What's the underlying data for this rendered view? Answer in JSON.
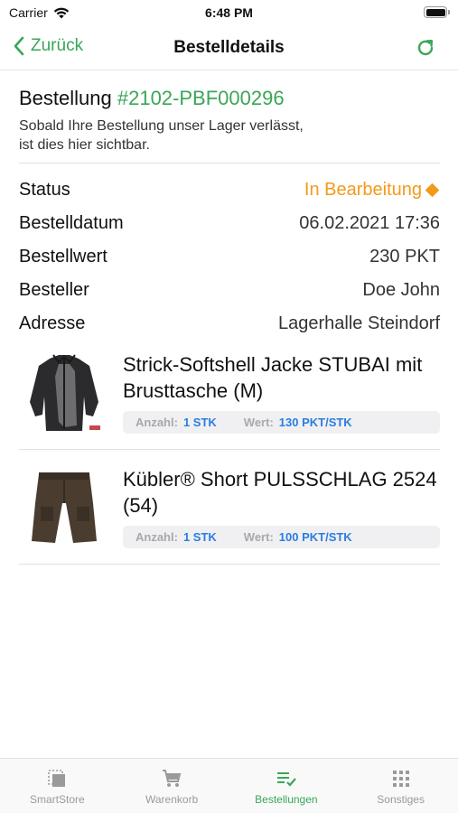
{
  "status_bar": {
    "carrier": "Carrier",
    "time": "6:48 PM"
  },
  "navbar": {
    "back_label": "Zurück",
    "title": "Bestelldetails"
  },
  "order": {
    "heading_prefix": "Bestellung ",
    "number": "#2102-PBF000296",
    "note": "Sobald Ihre Bestellung unser Lager verlässt, ist dies hier sichtbar."
  },
  "details": [
    {
      "label": "Status",
      "value": "In Bearbeitung"
    },
    {
      "label": "Bestelldatum",
      "value": "06.02.2021 17:36"
    },
    {
      "label": "Bestellwert",
      "value": "230 PKT"
    },
    {
      "label": "Besteller",
      "value": "Doe John"
    },
    {
      "label": "Adresse",
      "value": "Lagerhalle Steindorf"
    }
  ],
  "products": [
    {
      "name": "Strick-Softshell Jacke STUBAI mit Brusttasche (M)",
      "quantity_label": "Anzahl:",
      "quantity": "1 STK",
      "value_label": "Wert:",
      "value": "130 PKT/STK"
    },
    {
      "name": "Kübler® Short PULSSCHLAG 2524 (54)",
      "quantity_label": "Anzahl:",
      "quantity": "1 STK",
      "value_label": "Wert:",
      "value": "100 PKT/STK"
    }
  ],
  "tabs": [
    {
      "label": "SmartStore",
      "icon": "store-icon",
      "active": false
    },
    {
      "label": "Warenkorb",
      "icon": "cart-icon",
      "active": false
    },
    {
      "label": "Bestellungen",
      "icon": "orders-icon",
      "active": true
    },
    {
      "label": "Sonstiges",
      "icon": "grid-icon",
      "active": false
    }
  ],
  "colors": {
    "accent": "#3aa657",
    "status_orange": "#f29a1b",
    "meta_value_blue": "#2a7de1"
  }
}
